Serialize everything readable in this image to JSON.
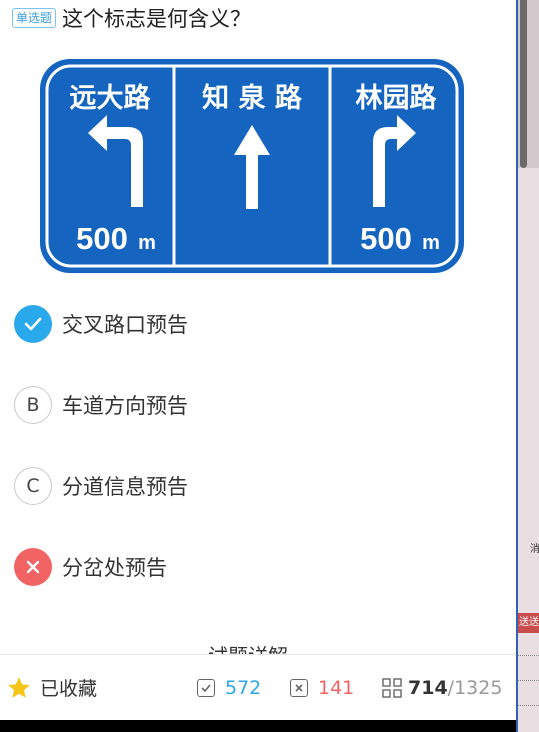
{
  "question": {
    "type_badge": "单选题",
    "text": "这个标志是何含义？"
  },
  "sign": {
    "left_road": "远大路",
    "center_road": "知 泉 路",
    "right_road": "林园路",
    "left_distance": "500",
    "right_distance": "500",
    "unit": "m",
    "colors": {
      "blue": "#1565c0",
      "white": "#ffffff"
    }
  },
  "options": [
    {
      "marker": "",
      "state": "correct",
      "text": "交叉路口预告"
    },
    {
      "marker": "B",
      "state": "plain",
      "text": "车道方向预告"
    },
    {
      "marker": "C",
      "state": "plain",
      "text": "分道信息预告"
    },
    {
      "marker": "",
      "state": "wrong",
      "text": "分岔处预告"
    }
  ],
  "explanation_title": "试题详解",
  "bottom_bar": {
    "favorite_label": "已收藏",
    "correct_count": "572",
    "wrong_count": "141",
    "current_index": "714",
    "total": "/1325",
    "colors": {
      "correct": "#29a9ec",
      "wrong": "#f26363",
      "star": "#f5c518"
    }
  },
  "side_panel": {
    "text_top": "消",
    "text_red": "送送("
  }
}
